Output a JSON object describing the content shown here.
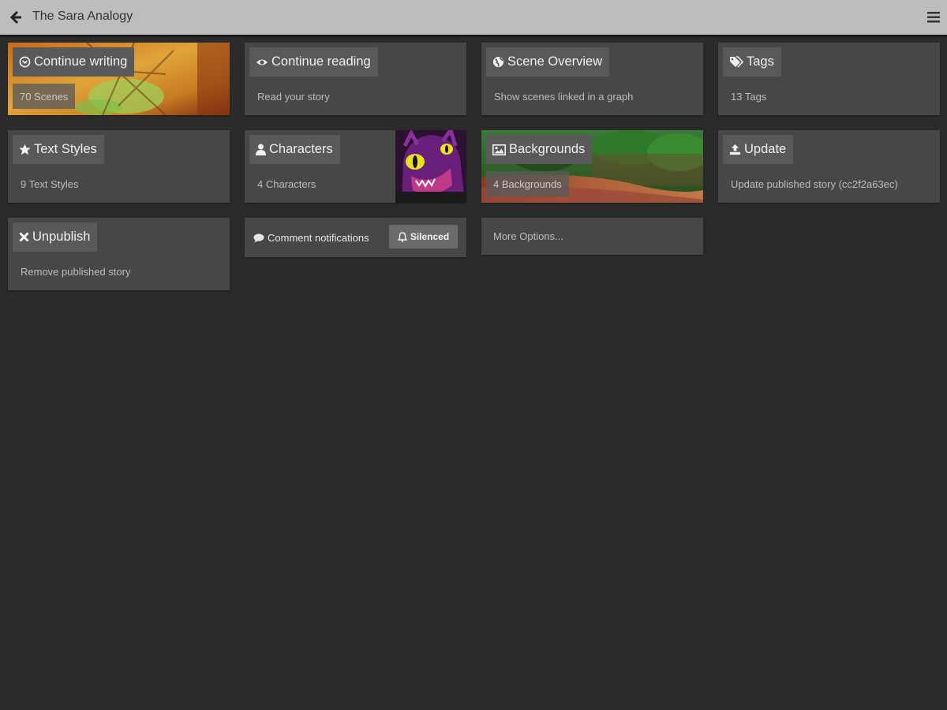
{
  "header": {
    "title": "The Sara Analogy"
  },
  "cards": {
    "continue_writing": {
      "label": "Continue writing",
      "sub": "70 Scenes"
    },
    "continue_reading": {
      "label": "Continue reading",
      "sub": "Read your story"
    },
    "scene_overview": {
      "label": "Scene Overview",
      "sub": "Show scenes linked in a graph"
    },
    "tags": {
      "label": "Tags",
      "sub": "13 Tags"
    },
    "text_styles": {
      "label": "Text Styles",
      "sub": "9 Text Styles"
    },
    "characters": {
      "label": "Characters",
      "sub": "4 Characters"
    },
    "backgrounds": {
      "label": "Backgrounds",
      "sub": "4 Backgrounds"
    },
    "update": {
      "label": "Update",
      "sub": "Update published story (cc2f2a63ec)"
    },
    "unpublish": {
      "label": "Unpublish",
      "sub": "Remove published story"
    }
  },
  "notifications": {
    "label": "Comment notifications",
    "status": "Silenced"
  },
  "more_options": {
    "label": "More Options..."
  },
  "icons": {
    "back": "arrow-left-icon",
    "menu": "hamburger-menu-icon",
    "continue_writing": "circle-arrow-icon",
    "continue_reading": "eye-icon",
    "scene_overview": "globe-icon",
    "tags": "tags-icon",
    "text_styles": "star-icon",
    "characters": "user-icon",
    "backgrounds": "image-icon",
    "update": "upload-icon",
    "unpublish": "times-icon",
    "notifications": "comment-icon",
    "silenced": "bell-icon"
  },
  "colors": {
    "background": "#2b2b2b",
    "topbar": "#bdbdbd",
    "card": "#474747",
    "button": "#595959",
    "subtext": "#bcbcbd"
  }
}
